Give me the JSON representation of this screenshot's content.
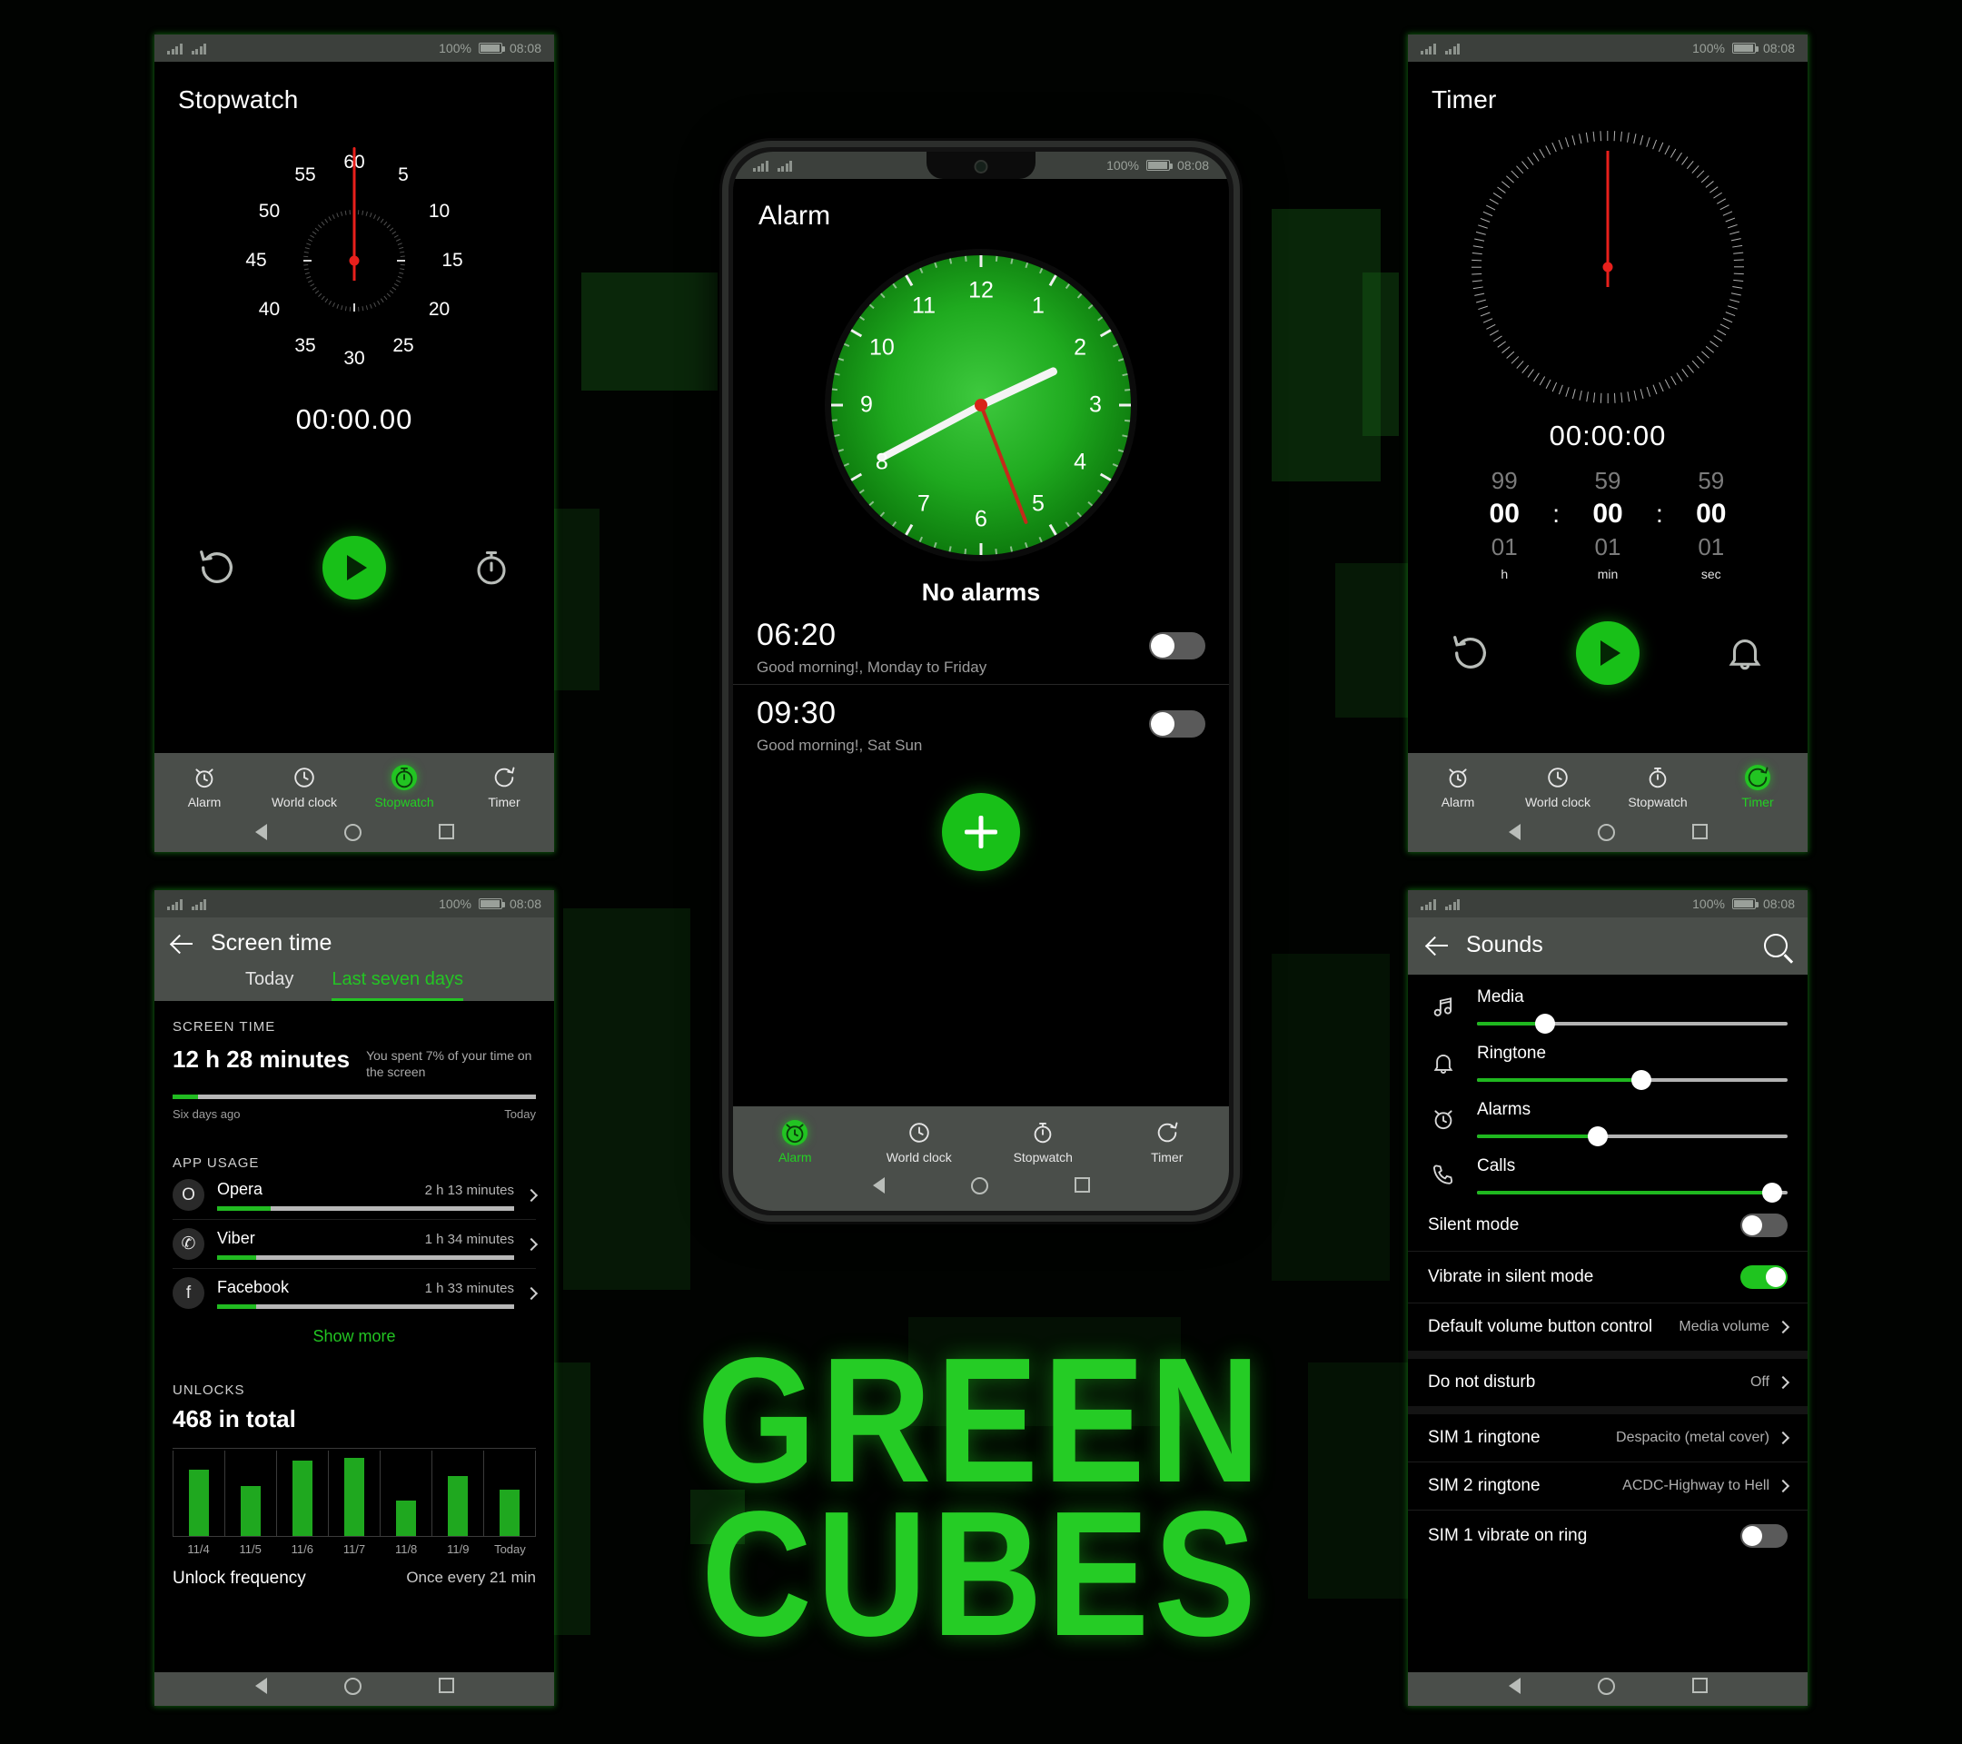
{
  "statusbar": {
    "battery_pct": "100%",
    "time": "08:08"
  },
  "wordmark": {
    "line1": "GREEN",
    "line2": "CUBES"
  },
  "colors": {
    "accent_green": "#22c422",
    "needle_red": "#e8201c",
    "nav_bg": "#4a4e4a"
  },
  "stopwatch_panel": {
    "title": "Stopwatch",
    "time": "00:00.00",
    "dial_numbers": [
      "60",
      "5",
      "10",
      "15",
      "20",
      "25",
      "30",
      "35",
      "40",
      "45",
      "50",
      "55"
    ],
    "controls": {
      "reset_icon": "reset-icon",
      "play_icon": "play-icon",
      "lap_icon": "lap-timer-icon"
    },
    "nav": [
      {
        "label": "Alarm",
        "icon": "alarm-clock-icon",
        "active": false
      },
      {
        "label": "World clock",
        "icon": "clock-icon",
        "active": false
      },
      {
        "label": "Stopwatch",
        "icon": "stopwatch-icon",
        "active": true
      },
      {
        "label": "Timer",
        "icon": "timer-icon",
        "active": false
      }
    ]
  },
  "timer_panel": {
    "title": "Timer",
    "time": "00:00:00",
    "picker": {
      "above": [
        "99",
        "59",
        "59"
      ],
      "current": [
        "00",
        "00",
        "00"
      ],
      "below": [
        "01",
        "01",
        "01"
      ],
      "units": [
        "h",
        "min",
        "sec"
      ],
      "separator": ":"
    },
    "controls": {
      "reset_icon": "reset-icon",
      "play_icon": "play-icon",
      "bell_icon": "bell-icon"
    },
    "nav": [
      {
        "label": "Alarm",
        "icon": "alarm-clock-icon",
        "active": false
      },
      {
        "label": "World clock",
        "icon": "clock-icon",
        "active": false
      },
      {
        "label": "Stopwatch",
        "icon": "stopwatch-icon",
        "active": false
      },
      {
        "label": "Timer",
        "icon": "timer-icon",
        "active": true
      }
    ]
  },
  "alarm_phone": {
    "title": "Alarm",
    "clock_numbers": [
      "12",
      "1",
      "2",
      "3",
      "4",
      "5",
      "6",
      "7",
      "8",
      "9",
      "10",
      "11"
    ],
    "no_alarms_text": "No alarms",
    "alarms": [
      {
        "time": "06:20",
        "sub": "Good morning!, Monday to Friday",
        "enabled": false
      },
      {
        "time": "09:30",
        "sub": "Good morning!, Sat Sun",
        "enabled": false
      }
    ],
    "add_button": "add-alarm-button",
    "nav": [
      {
        "label": "Alarm",
        "icon": "alarm-clock-icon",
        "active": true
      },
      {
        "label": "World clock",
        "icon": "clock-icon",
        "active": false
      },
      {
        "label": "Stopwatch",
        "icon": "stopwatch-icon",
        "active": false
      },
      {
        "label": "Timer",
        "icon": "timer-icon",
        "active": false
      }
    ]
  },
  "screen_time_panel": {
    "title": "Screen time",
    "tabs": [
      {
        "label": "Today",
        "active": false
      },
      {
        "label": "Last seven days",
        "active": true
      }
    ],
    "screen_time": {
      "section_label": "SCREEN TIME",
      "total": "12 h 28 minutes",
      "note": "You spent 7% of your time on the screen",
      "progress_pct": 7,
      "left_label": "Six days ago",
      "right_label": "Today"
    },
    "app_usage": {
      "section_label": "APP USAGE",
      "apps": [
        {
          "name": "Opera",
          "time": "2 h 13 minutes",
          "pct": 18,
          "glyph": "O"
        },
        {
          "name": "Viber",
          "time": "1 h 34 minutes",
          "pct": 13,
          "glyph": "✆"
        },
        {
          "name": "Facebook",
          "time": "1 h 33 minutes",
          "pct": 13,
          "glyph": "f"
        }
      ],
      "show_more": "Show more"
    },
    "unlocks": {
      "section_label": "UNLOCKS",
      "total": "468 in total",
      "frequency_label": "Unlock frequency",
      "frequency_value": "Once every 21 min"
    },
    "chart_data": {
      "type": "bar",
      "title": "UNLOCKS",
      "categories": [
        "11/4",
        "11/5",
        "11/6",
        "11/7",
        "11/8",
        "11/9",
        "Today"
      ],
      "values": [
        78,
        59,
        88,
        92,
        42,
        70,
        54
      ],
      "xlabel": "",
      "ylabel": "",
      "ylim": [
        0,
        100
      ],
      "grid": true,
      "legend": "none",
      "series_color": "#1fa81f"
    }
  },
  "sounds_panel": {
    "title": "Sounds",
    "search_icon": "search-icon",
    "sliders": [
      {
        "label": "Media",
        "icon": "music-note-icon",
        "value": 22
      },
      {
        "label": "Ringtone",
        "icon": "bell-icon",
        "value": 53
      },
      {
        "label": "Alarms",
        "icon": "alarm-clock-icon",
        "value": 39
      },
      {
        "label": "Calls",
        "icon": "phone-icon",
        "value": 95
      }
    ],
    "options": [
      {
        "label": "Silent mode",
        "type": "switch",
        "on": false
      },
      {
        "label": "Vibrate in silent mode",
        "type": "switch",
        "on": true
      },
      {
        "label": "Default volume button control",
        "type": "value",
        "value": "Media volume"
      }
    ],
    "options2": [
      {
        "label": "Do not disturb",
        "type": "value",
        "value": "Off"
      }
    ],
    "options3": [
      {
        "label": "SIM 1 ringtone",
        "type": "value",
        "value": "Despacito (metal cover)"
      },
      {
        "label": "SIM 2 ringtone",
        "type": "value",
        "value": "ACDC-Highway to Hell"
      },
      {
        "label": "SIM 1 vibrate on ring",
        "type": "switch",
        "on": false
      }
    ]
  }
}
